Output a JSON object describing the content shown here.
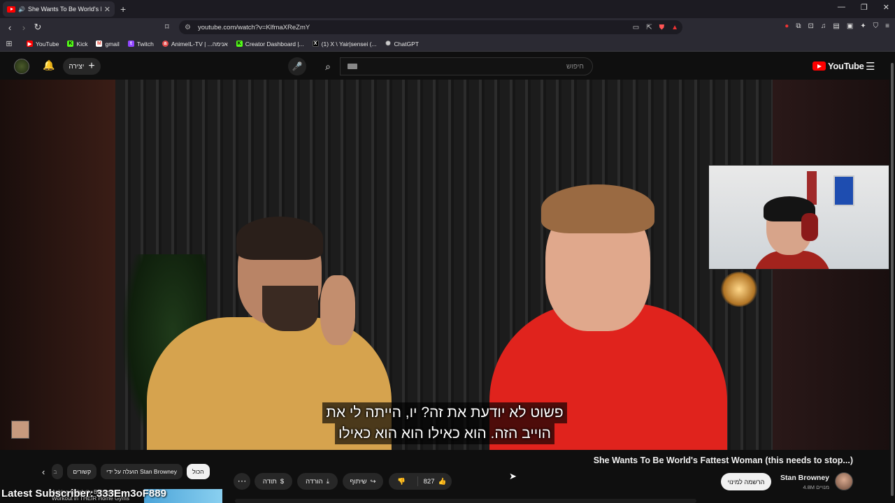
{
  "browser": {
    "tab_title": "She Wants To Be World's Fatt",
    "url": "youtube.com/watch?v=KlfmaXReZmY",
    "bookmarks": [
      {
        "label": "YouTube",
        "icon": "youtube-icon",
        "color": "#ff0000"
      },
      {
        "label": "Kick",
        "icon": "kick-icon",
        "color": "#53fc18"
      },
      {
        "label": "gmail",
        "icon": "gmail-icon",
        "color": "#ea4335"
      },
      {
        "label": "Twitch",
        "icon": "twitch-icon",
        "color": "#9146ff"
      },
      {
        "label": "AnimeIL-TV | ...אנימה",
        "icon": "animeil-icon",
        "color": "#e34b4b"
      },
      {
        "label": "Creator Dashboard |...",
        "icon": "kick-icon",
        "color": "#53fc18"
      },
      {
        "label": "(1) X \\ Yair|sensei (...",
        "icon": "x-icon",
        "color": "#ffffff"
      },
      {
        "label": "ChatGPT",
        "icon": "chatgpt-icon",
        "color": "#cccccc"
      }
    ]
  },
  "youtube": {
    "create_label": "יצירה",
    "search_placeholder": "חיפוש",
    "logo_text": "YouTube",
    "subtitles": [
      "פשוט לא יודעת את זה?  יו, הייתה לי את",
      "הוייב הזה.  הוא כאילו הוא הוא כאילו"
    ],
    "video_title": "She Wants To Be World's Fattest Woman (this needs to stop...)",
    "channel_name": "Stan Browney",
    "subscriber_count": "4.8M מנויים",
    "subscribe_label": "הרשמה למינוי",
    "like_count": "827",
    "share_label": "שיתוף",
    "download_label": "הורדה",
    "thanks_label": "תודה",
    "chips": {
      "all": "הכול",
      "uploaded_by": "הועלה על ידי Stan Browney",
      "related": "קשורים",
      "partial": "ב"
    },
    "overlay_text": "Latest Subscriber: 333Em3oF889",
    "rec_title": "Asking Celebrity Billionaires... Workout in THEIR Home Gyms"
  },
  "colors": {
    "accent": "#ff0000",
    "background": "#0f0f0f"
  }
}
